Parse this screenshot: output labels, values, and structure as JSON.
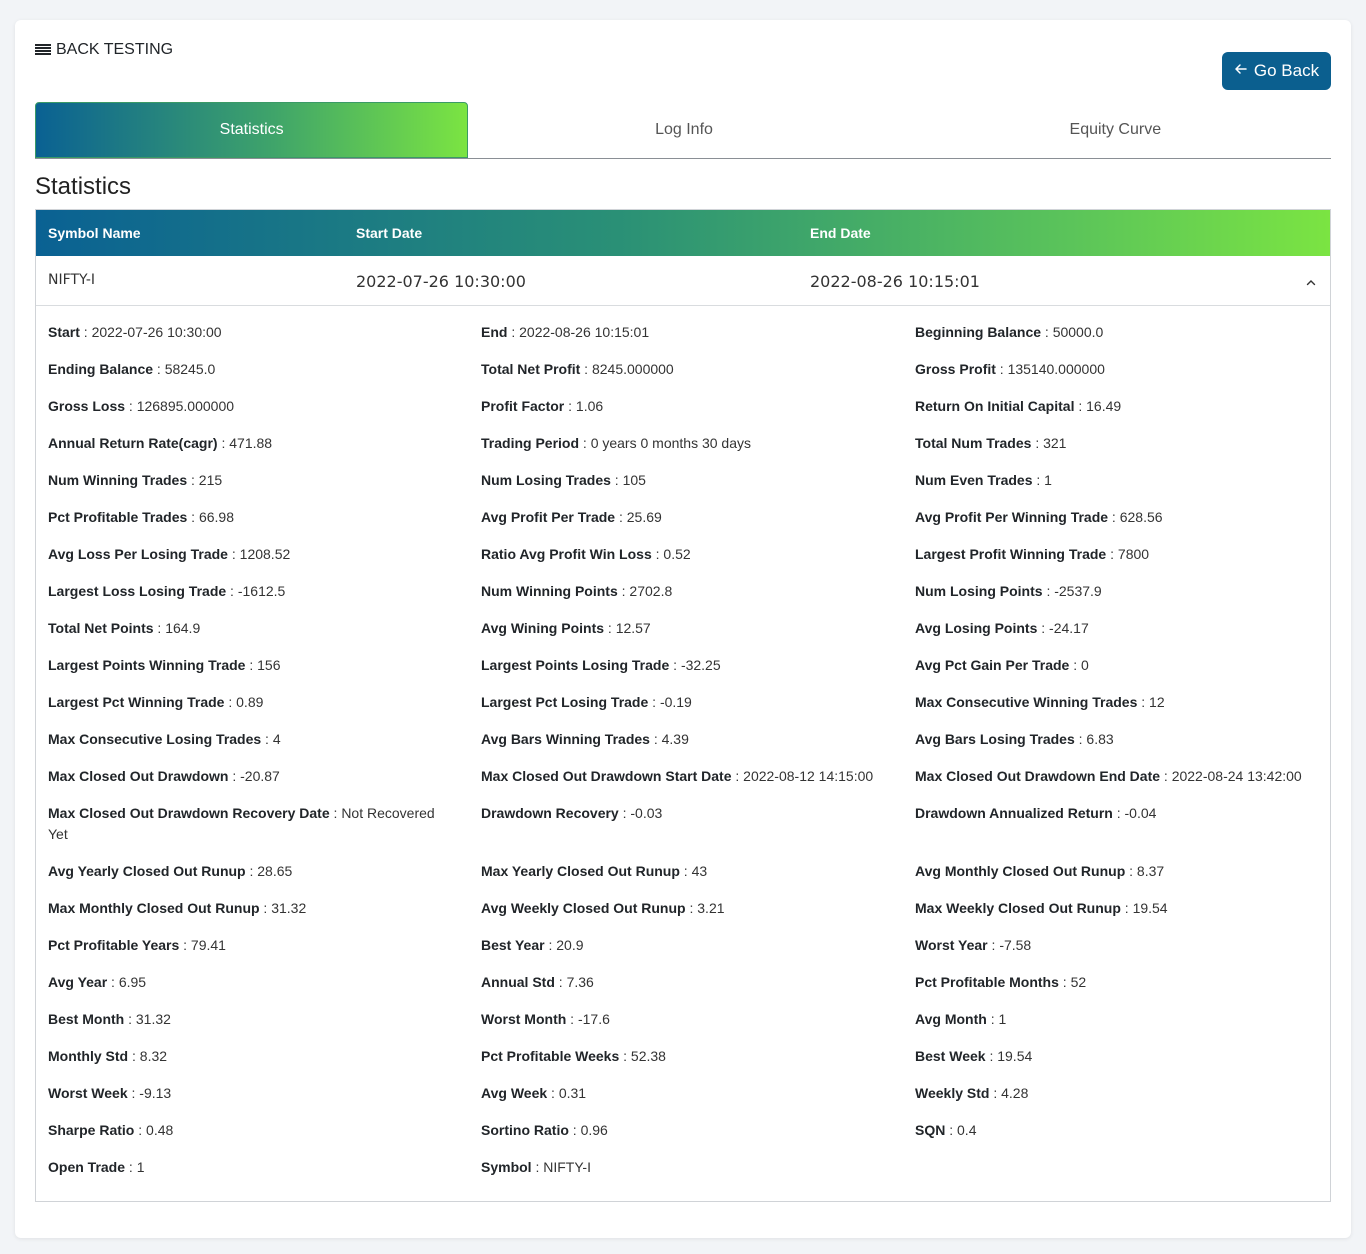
{
  "header": {
    "title": "BACK TESTING",
    "go_back_label": "Go Back"
  },
  "tabs": [
    {
      "label": "Statistics",
      "active": true
    },
    {
      "label": "Log Info",
      "active": false
    },
    {
      "label": "Equity Curve",
      "active": false
    }
  ],
  "section_title": "Statistics",
  "table": {
    "columns": [
      "Symbol Name",
      "Start Date",
      "End Date"
    ],
    "row": {
      "symbol": "NIFTY-I",
      "start": "2022-07-26 10:30:00",
      "end": "2022-08-26 10:15:01"
    }
  },
  "stats": [
    [
      "Start",
      "2022-07-26 10:30:00"
    ],
    [
      "End",
      "2022-08-26 10:15:01"
    ],
    [
      "Beginning Balance",
      "50000.0"
    ],
    [
      "Ending Balance",
      "58245.0"
    ],
    [
      "Total Net Profit",
      "8245.000000"
    ],
    [
      "Gross Profit",
      "135140.000000"
    ],
    [
      "Gross Loss",
      "126895.000000"
    ],
    [
      "Profit Factor",
      "1.06"
    ],
    [
      "Return On Initial Capital",
      "16.49"
    ],
    [
      "Annual Return Rate(cagr)",
      "471.88"
    ],
    [
      "Trading Period",
      "0 years 0 months 30 days"
    ],
    [
      "Total Num Trades",
      "321"
    ],
    [
      "Num Winning Trades",
      "215"
    ],
    [
      "Num Losing Trades",
      "105"
    ],
    [
      "Num Even Trades",
      "1"
    ],
    [
      "Pct Profitable Trades",
      "66.98"
    ],
    [
      "Avg Profit Per Trade",
      "25.69"
    ],
    [
      "Avg Profit Per Winning Trade",
      "628.56"
    ],
    [
      "Avg Loss Per Losing Trade",
      "1208.52"
    ],
    [
      "Ratio Avg Profit Win Loss",
      "0.52"
    ],
    [
      "Largest Profit Winning Trade",
      "7800"
    ],
    [
      "Largest Loss Losing Trade",
      "-1612.5"
    ],
    [
      "Num Winning Points",
      "2702.8"
    ],
    [
      "Num Losing Points",
      "-2537.9"
    ],
    [
      "Total Net Points",
      "164.9"
    ],
    [
      "Avg Wining Points",
      "12.57"
    ],
    [
      "Avg Losing Points",
      "-24.17"
    ],
    [
      "Largest Points Winning Trade",
      "156"
    ],
    [
      "Largest Points Losing Trade",
      "-32.25"
    ],
    [
      "Avg Pct Gain Per Trade",
      "0"
    ],
    [
      "Largest Pct Winning Trade",
      "0.89"
    ],
    [
      "Largest Pct Losing Trade",
      "-0.19"
    ],
    [
      "Max Consecutive Winning Trades",
      "12"
    ],
    [
      "Max Consecutive Losing Trades",
      "4"
    ],
    [
      "Avg Bars Winning Trades",
      "4.39"
    ],
    [
      "Avg Bars Losing Trades",
      "6.83"
    ],
    [
      "Max Closed Out Drawdown",
      "-20.87"
    ],
    [
      "Max Closed Out Drawdown Start Date",
      "2022-08-12 14:15:00"
    ],
    [
      "Max Closed Out Drawdown End Date",
      "2022-08-24 13:42:00"
    ],
    [
      "Max Closed Out Drawdown Recovery Date",
      "Not Recovered Yet"
    ],
    [
      "Drawdown Recovery",
      "-0.03"
    ],
    [
      "Drawdown Annualized Return",
      "-0.04"
    ],
    [
      "Avg Yearly Closed Out Runup",
      "28.65"
    ],
    [
      "Max Yearly Closed Out Runup",
      "43"
    ],
    [
      "Avg Monthly Closed Out Runup",
      "8.37"
    ],
    [
      "Max Monthly Closed Out Runup",
      "31.32"
    ],
    [
      "Avg Weekly Closed Out Runup",
      "3.21"
    ],
    [
      "Max Weekly Closed Out Runup",
      "19.54"
    ],
    [
      "Pct Profitable Years",
      "79.41"
    ],
    [
      "Best Year",
      "20.9"
    ],
    [
      "Worst Year",
      "-7.58"
    ],
    [
      "Avg Year",
      "6.95"
    ],
    [
      "Annual Std",
      "7.36"
    ],
    [
      "Pct Profitable Months",
      "52"
    ],
    [
      "Best Month",
      "31.32"
    ],
    [
      "Worst Month",
      "-17.6"
    ],
    [
      "Avg Month",
      "1"
    ],
    [
      "Monthly Std",
      "8.32"
    ],
    [
      "Pct Profitable Weeks",
      "52.38"
    ],
    [
      "Best Week",
      "19.54"
    ],
    [
      "Worst Week",
      "-9.13"
    ],
    [
      "Avg Week",
      "0.31"
    ],
    [
      "Weekly Std",
      "4.28"
    ],
    [
      "Sharpe Ratio",
      "0.48"
    ],
    [
      "Sortino Ratio",
      "0.96"
    ],
    [
      "SQN",
      "0.4"
    ],
    [
      "Open Trade",
      "1"
    ],
    [
      "Symbol",
      "NIFTY-I"
    ]
  ]
}
